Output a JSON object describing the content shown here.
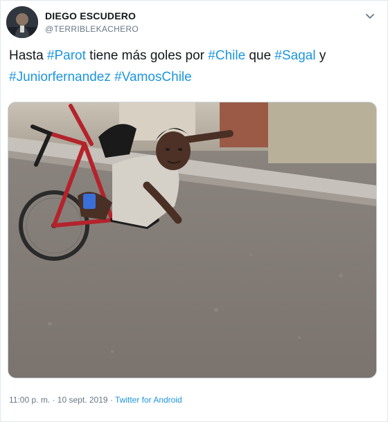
{
  "author": {
    "name": "DIEGO ESCUDERO",
    "handle": "@TERRIBLEKACHERO",
    "avatar_icon": "user-avatar"
  },
  "tweet": {
    "segments": [
      {
        "text": "Hasta ",
        "type": "text"
      },
      {
        "text": "#Parot",
        "type": "hashtag"
      },
      {
        "text": " tiene más goles por ",
        "type": "text"
      },
      {
        "text": "#Chile",
        "type": "hashtag"
      },
      {
        "text": " que ",
        "type": "text"
      },
      {
        "text": "#Sagal",
        "type": "hashtag"
      },
      {
        "text": " y ",
        "type": "text"
      },
      {
        "text": "#Juniorfernandez",
        "type": "hashtag"
      },
      {
        "text": " ",
        "type": "text"
      },
      {
        "text": "#VamosChile",
        "type": "hashtag"
      }
    ]
  },
  "media": {
    "kind": "photo",
    "icon": "tweet-photo"
  },
  "footer": {
    "timestamp": "11:00 p. m. · 10 sept. 2019 · ",
    "source": "Twitter for Android"
  },
  "colors": {
    "hashtag": "#1b95e0",
    "text": "#14171a",
    "secondary": "#657786",
    "border": "#e1e8ed"
  },
  "header": {
    "more_icon": "chevron-down-icon"
  }
}
